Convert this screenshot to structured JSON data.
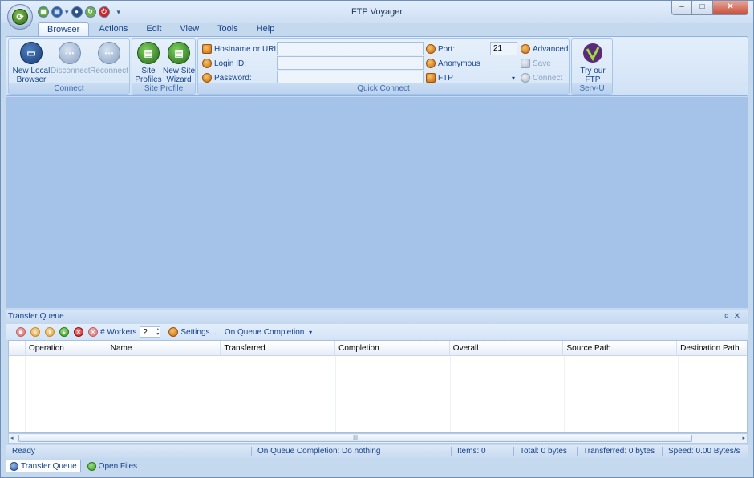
{
  "window": {
    "title": "FTP Voyager"
  },
  "controls": {
    "minimize": "–",
    "maximize": "□",
    "close": "✕"
  },
  "quick_access": {
    "dropdown_glyph": "▾",
    "customize_glyph": "▾"
  },
  "tabs": [
    {
      "label": "Browser",
      "active": true
    },
    {
      "label": "Actions"
    },
    {
      "label": "Edit"
    },
    {
      "label": "View"
    },
    {
      "label": "Tools"
    },
    {
      "label": "Help"
    }
  ],
  "ribbon": {
    "connect": {
      "label": "Connect",
      "new_local_browser": "New Local Browser",
      "disconnect": "Disconnect",
      "reconnect": "Reconnect"
    },
    "site_profile": {
      "label": "Site Profile",
      "site_profiles": "Site Profiles",
      "new_site_wizard": "New Site Wizard"
    },
    "quick_connect": {
      "label": "Quick Connect",
      "hostname_label": "Hostname or URL:",
      "hostname_value": "",
      "login_label": "Login ID:",
      "login_value": "",
      "password_label": "Password:",
      "password_value": "",
      "port_label": "Port:",
      "port_value": "21",
      "anonymous": "Anonymous",
      "protocol": "FTP",
      "protocol_arrow": "▾",
      "advanced": "Advanced",
      "save": "Save",
      "connect": "Connect"
    },
    "servu": {
      "label": "Serv-U",
      "try_server": "Try our FTP Server"
    }
  },
  "transfer_queue": {
    "title": "Transfer Queue",
    "pin_glyph": "¤",
    "close_glyph": "✕",
    "workers_label": "# Workers",
    "workers_value": "2",
    "settings_label": "Settings...",
    "on_queue_completion": "On Queue Completion",
    "dropdown_glyph": "▾",
    "columns": [
      "Operation",
      "Name",
      "Transferred",
      "Completion",
      "Overall",
      "Source Path",
      "Destination Path"
    ],
    "rows": []
  },
  "scrollbar": {
    "grip": "III",
    "left_arrow": "◂",
    "right_arrow": "▸"
  },
  "status": {
    "ready": "Ready",
    "completion": "On Queue Completion: Do nothing",
    "items": "Items: 0",
    "total": "Total: 0 bytes",
    "transferred": "Transferred: 0 bytes",
    "speed": "Speed: 0.00 Bytes/s"
  },
  "bottom_tabs": [
    {
      "label": "Transfer Queue",
      "active": true
    },
    {
      "label": "Open Files"
    }
  ]
}
